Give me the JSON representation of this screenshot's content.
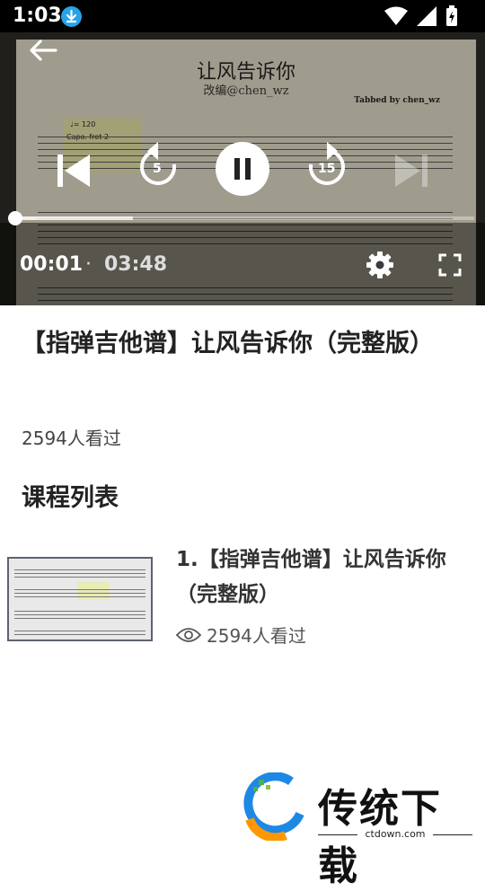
{
  "status_bar": {
    "time": "1:03"
  },
  "sheet": {
    "title": "让风告诉你",
    "subtitle": "改编@chen_wz",
    "tabbed_by": "Tabbed by chen_wz",
    "tempo": "♩= 120",
    "capo": "Capo. fret 2"
  },
  "player": {
    "rewind_seconds": "5",
    "forward_seconds": "15",
    "current_time": "00:01",
    "separator": "·",
    "total_time": "03:48",
    "progress_fraction": 0.005,
    "buffer_fraction": 0.26
  },
  "video_title": "【指弹吉他谱】让风告诉你（完整版）",
  "views": "2594人看过",
  "course_list_heading": "课程列表",
  "course_items": [
    {
      "title": "1.【指弹吉他谱】让风告诉你（完整版）",
      "views": "2594人看过"
    }
  ],
  "watermark": {
    "brand": "传统下载",
    "url": "ctdown.com"
  }
}
